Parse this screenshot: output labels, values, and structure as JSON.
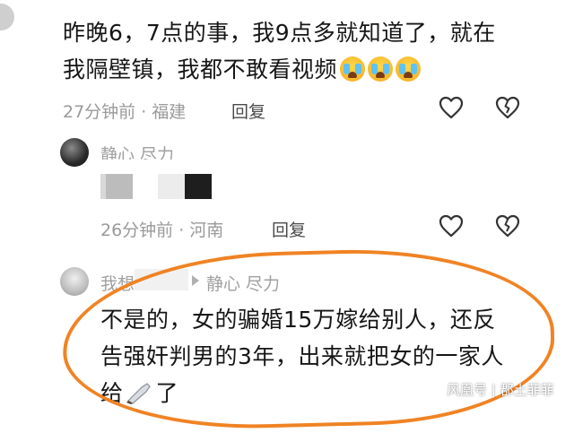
{
  "comment1": {
    "line1": "昨晚6，7点的事，我9点多就知道了，就在",
    "line2": "我隔壁镇，我都不敢看视频",
    "time": "27分钟前",
    "location": "福建",
    "reply_label": "回复"
  },
  "comment2": {
    "author": "静心 尽力",
    "time": "26分钟前",
    "location": "河南",
    "reply_label": "回复"
  },
  "comment3": {
    "author_prefix": "我想",
    "reply_to": "静心 尽力",
    "line1": "不是的，女的骗婚15万嫁给别人，还反",
    "line2": "告强奸判男的3年，出来就把女的一家人",
    "line3_start": "给",
    "line3_end": "了"
  },
  "watermark": "风凰号 | 郡土菲菲",
  "colors": {
    "highlight": "#f08324",
    "meta": "#9a9a9a"
  },
  "icons": {
    "like": "heart-outline-icon",
    "dislike": "broken-heart-icon",
    "emoji": "crying-face-icon",
    "knife": "knife-emoji-icon"
  }
}
